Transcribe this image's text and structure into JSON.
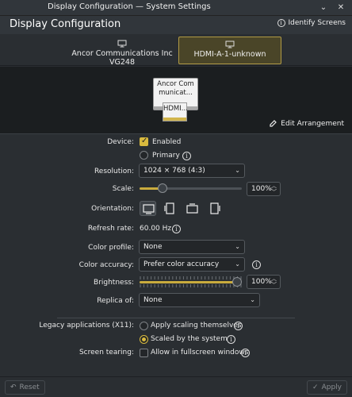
{
  "window": {
    "title": "Display Configuration — System Settings"
  },
  "header": {
    "title": "Display Configuration",
    "identify_label": "Identify Screens"
  },
  "tabs": [
    {
      "label": "Ancor Communications Inc VG248",
      "active": false
    },
    {
      "label": "HDMI-A-1-unknown",
      "active": true
    }
  ],
  "arrangement": {
    "screen1_label": "Ancor Communicat...",
    "screen2_label": "HDMI...",
    "edit_label": "Edit Arrangement"
  },
  "settings": {
    "device_label": "Device:",
    "enabled_label": "Enabled",
    "enabled": true,
    "primary_label": "Primary",
    "primary": false,
    "resolution_label": "Resolution:",
    "resolution_value": "1024 × 768 (4:3)",
    "scale_label": "Scale:",
    "scale_value": "100%",
    "scale_fraction": 0.2,
    "orientation_label": "Orientation:",
    "refresh_label": "Refresh rate:",
    "refresh_value": "60.00 Hz",
    "color_profile_label": "Color profile:",
    "color_profile_value": "None",
    "color_accuracy_label": "Color accuracy:",
    "color_accuracy_value": "Prefer color accuracy",
    "brightness_label": "Brightness:",
    "brightness_value": "100%",
    "brightness_fraction": 1.0,
    "replica_label": "Replica of:",
    "replica_value": "None"
  },
  "legacy": {
    "label": "Legacy applications (X11):",
    "option1": "Apply scaling themselves",
    "option2": "Scaled by the system",
    "selected": 2,
    "tearing_label": "Screen tearing:",
    "tearing_option": "Allow in fullscreen windows",
    "tearing_checked": false
  },
  "footer": {
    "reset_label": "Reset",
    "apply_label": "Apply"
  },
  "colors": {
    "accent": "#d8b93e",
    "background": "#2a2e32",
    "arrangement_bg": "#1b1e20"
  }
}
